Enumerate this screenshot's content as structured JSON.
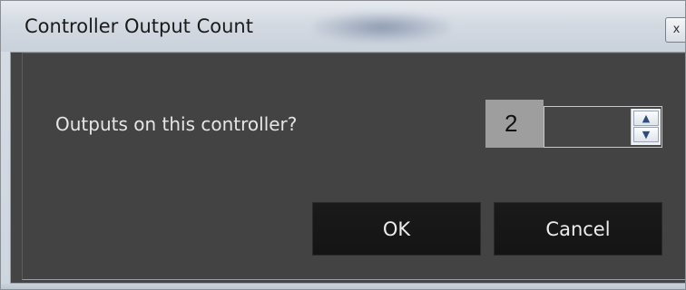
{
  "window": {
    "title": "Controller Output Count",
    "close_label": "x"
  },
  "dialog": {
    "prompt": "Outputs on this controller?",
    "outputs_value": "2",
    "spin_up_icon": "▲",
    "spin_down_icon": "▼",
    "ok_label": "OK",
    "cancel_label": "Cancel"
  },
  "colors": {
    "client_background": "#444444",
    "button_background": "#141414",
    "value_background": "#9e9e9e",
    "titlebar": "#d4dae2"
  }
}
